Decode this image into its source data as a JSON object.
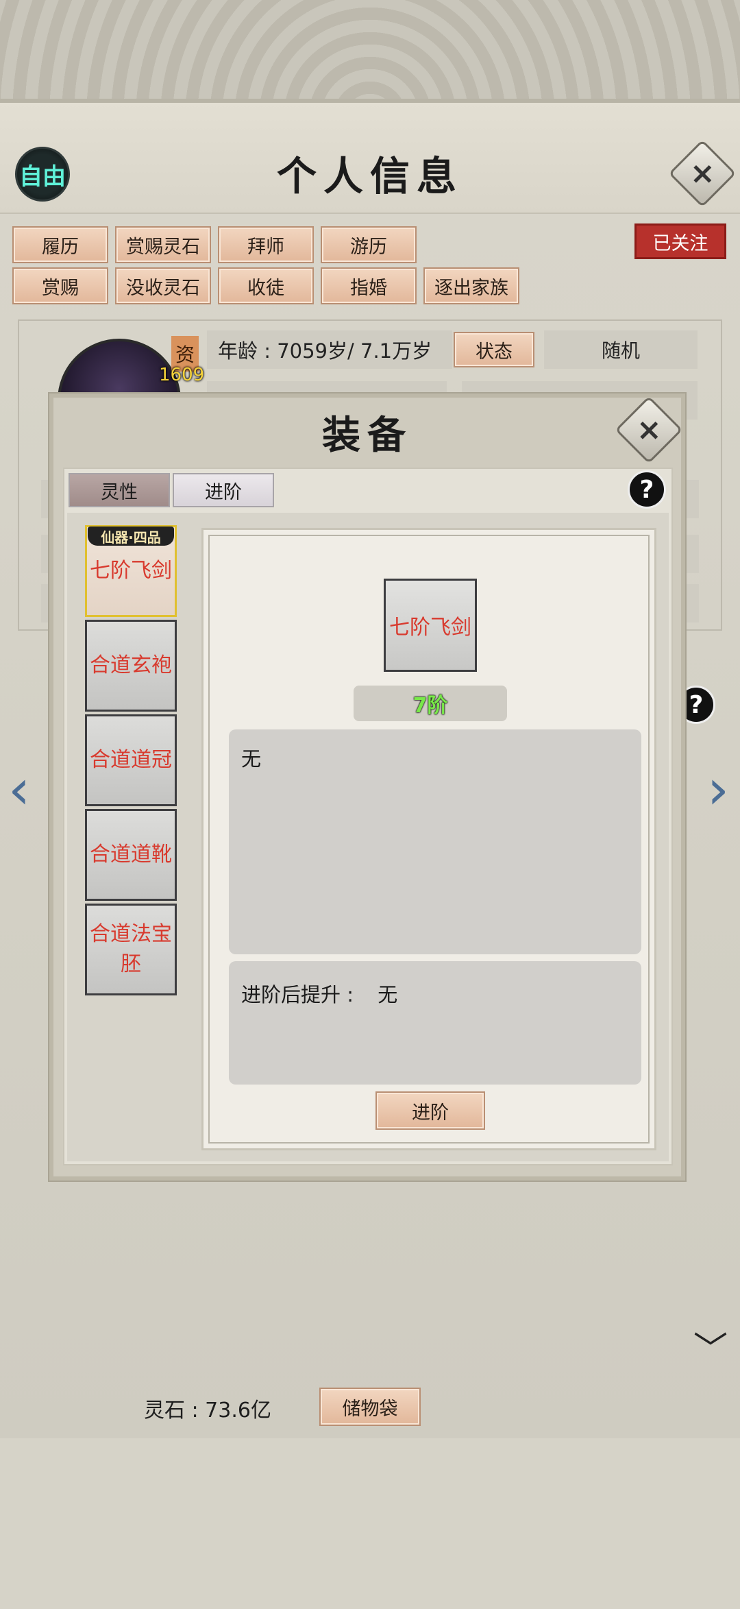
{
  "header": {
    "mode_badge": "自由",
    "title": "个人信息"
  },
  "actions": {
    "row1": [
      "履历",
      "赏赐灵石",
      "拜师",
      "游历"
    ],
    "row2": [
      "赏赐",
      "没收灵石",
      "收徒",
      "指婚",
      "逐出家族"
    ],
    "follow_status": "已关注"
  },
  "character": {
    "zi_label": "资",
    "zi_value": "1609",
    "age": "年龄 : 7059岁/ 7.1万岁",
    "status_button": "状态",
    "random_label": "随机"
  },
  "footer": {
    "spirit_stone": "灵石 : 73.6亿",
    "storage_button": "储物袋"
  },
  "modal": {
    "title": "装备",
    "tabs": [
      "灵性",
      "进阶"
    ],
    "active_tab": "灵性",
    "grade_tag": "仙器·四品",
    "equipment": [
      "七阶飞剑",
      "合道玄袍",
      "合道道冠",
      "合道道靴",
      "合道法宝胚"
    ],
    "selected": {
      "name": "七阶飞剑",
      "grade": "7阶",
      "description": "无",
      "upgrade_label": "进阶后提升 :",
      "upgrade_value": "无"
    },
    "advance_button": "进阶"
  },
  "colors": {
    "equipment_name": "#d83a2e",
    "grade_text": "#79e84a",
    "follow_bg": "#b7312c",
    "badge_text": "#5ff0d8"
  }
}
